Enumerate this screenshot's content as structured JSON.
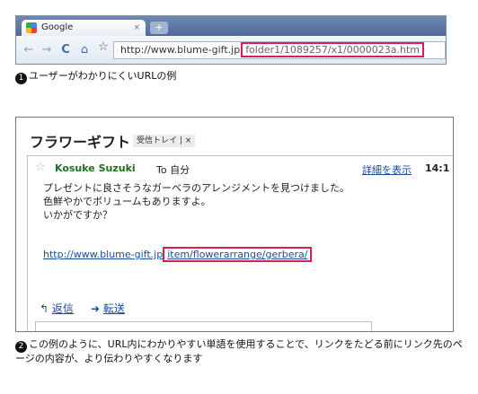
{
  "browser": {
    "tab_title": "Google",
    "tab_close": "×",
    "new_tab": "+",
    "back_icon": "←",
    "forward_icon": "→",
    "reload_icon": "C",
    "home_icon": "⌂",
    "star_icon": "☆",
    "url_base": "http://www.blume-gift.jp",
    "url_path": "folder1/1089257/x1/0000023a.htm"
  },
  "caption1": {
    "number": "1",
    "text": "ユーザーがわかりにくいURLの例"
  },
  "mail": {
    "subject": "フラワーギフト",
    "label": "受信トレイ | ×",
    "star_icon": "☆",
    "sender": "Kosuke Suzuki",
    "to": "To 自分",
    "details": "詳細を表示",
    "time": "14:1",
    "body": [
      "プレゼントに良さそうなガーベラのアレンジメントを見つけました。",
      "色鮮やかでボリュームもありますよ。",
      "いかがですか？"
    ],
    "link_base": "http://www.blume-gift.jp",
    "link_path": "item/flowerarrange/gerbera/",
    "reply_icon": "↰",
    "reply": "返信",
    "forward_icon": "➜",
    "forward": "転送"
  },
  "caption2": {
    "number": "2",
    "text": "この例のように、URL内にわかりやすい単語を使用することで、リンクをたどる前にリンク先のページの内容が、より伝わりやすくなります"
  },
  "colors": {
    "highlight": "#d6204f",
    "link": "#1b4da0",
    "sender": "#1f6f1f"
  }
}
